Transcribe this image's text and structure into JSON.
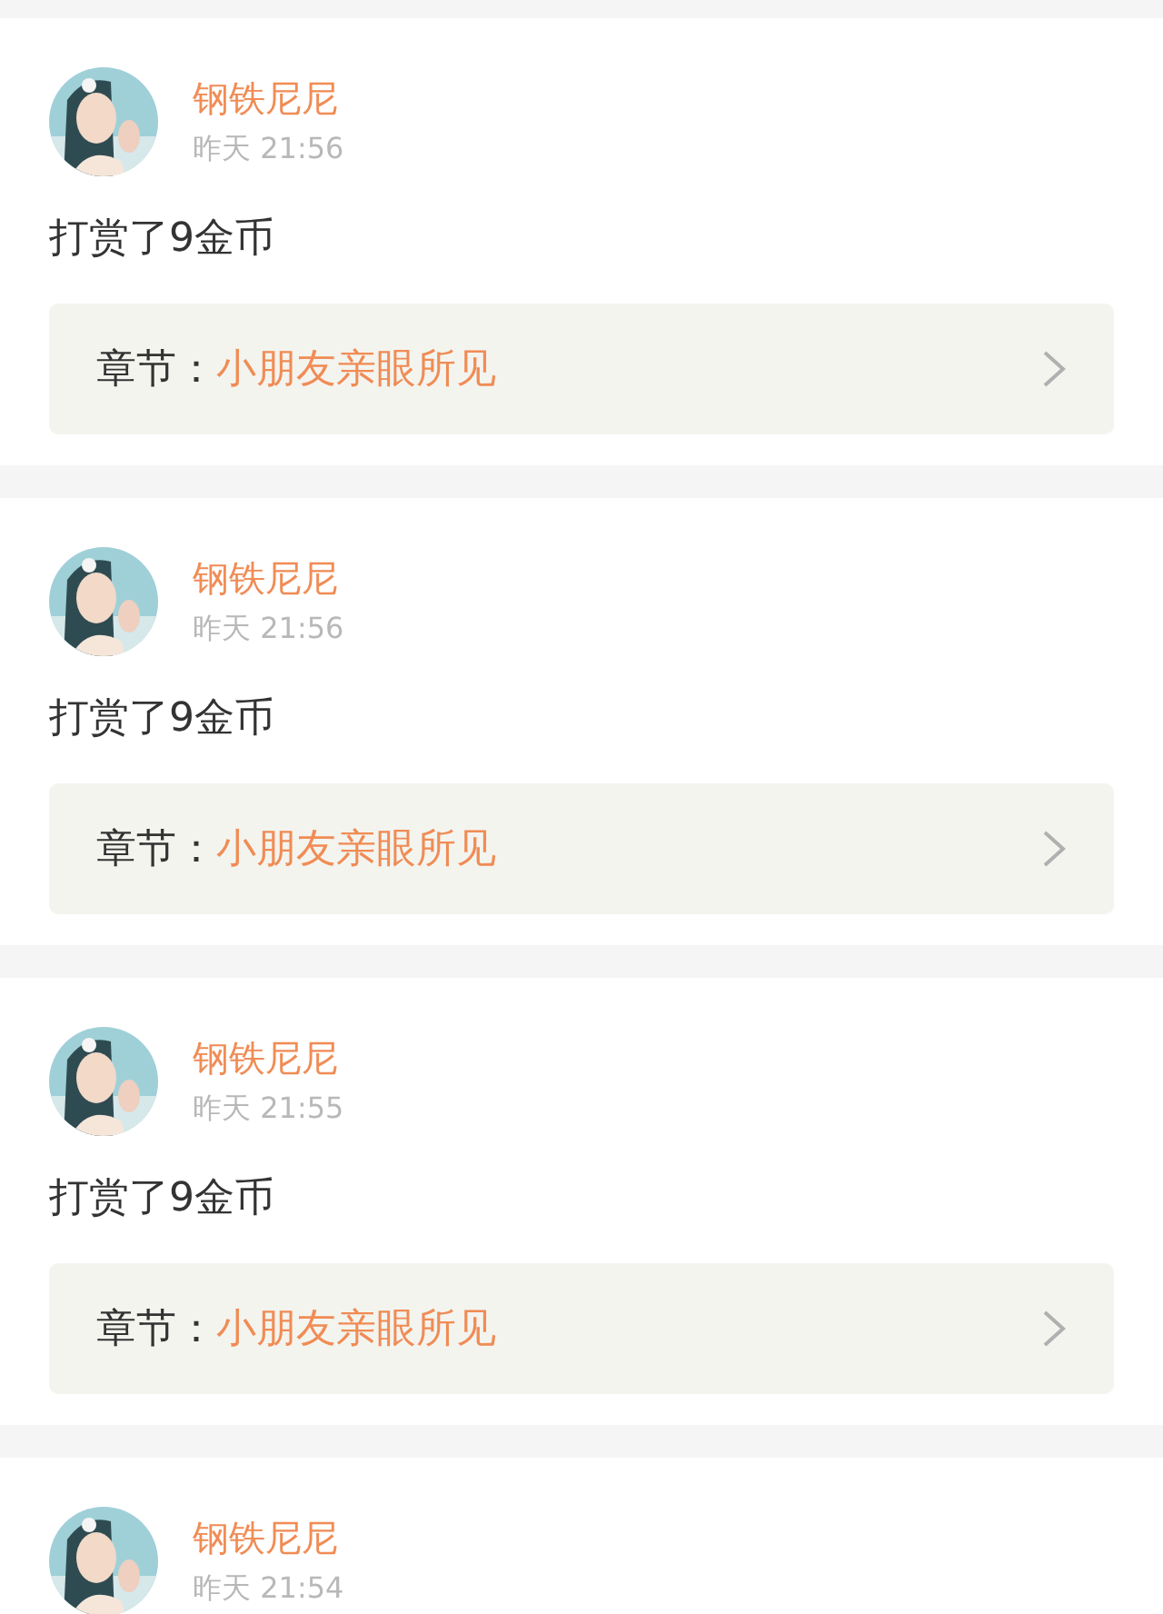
{
  "rewards": [
    {
      "name": "钢铁尼尼",
      "time": "昨天 21:56",
      "text": "打赏了9金币",
      "chapter_label": "章节：",
      "chapter_title": "小朋友亲眼所见"
    },
    {
      "name": "钢铁尼尼",
      "time": "昨天 21:56",
      "text": "打赏了9金币",
      "chapter_label": "章节：",
      "chapter_title": "小朋友亲眼所见"
    },
    {
      "name": "钢铁尼尼",
      "time": "昨天 21:55",
      "text": "打赏了9金币",
      "chapter_label": "章节：",
      "chapter_title": "小朋友亲眼所见"
    },
    {
      "name": "钢铁尼尼",
      "time": "昨天 21:54"
    }
  ]
}
